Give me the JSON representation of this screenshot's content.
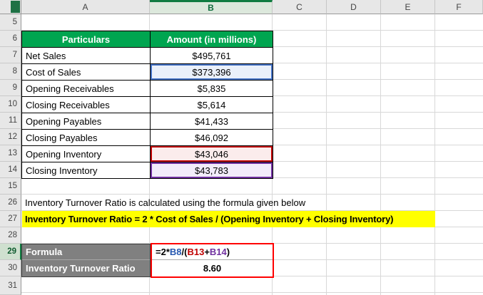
{
  "sheet": {
    "column_headers": [
      "A",
      "B",
      "C",
      "D",
      "E",
      "F"
    ],
    "row_headers": [
      "5",
      "6",
      "7",
      "8",
      "9",
      "10",
      "11",
      "12",
      "13",
      "14",
      "15",
      "26",
      "27",
      "28",
      "29",
      "30",
      "31"
    ]
  },
  "table": {
    "header": {
      "particulars": "Particulars",
      "amount": "Amount (in millions)"
    },
    "rows": [
      {
        "label": "Net Sales",
        "value": "$495,761"
      },
      {
        "label": "Cost of Sales",
        "value": "$373,396"
      },
      {
        "label": "Opening Receivables",
        "value": "$5,835"
      },
      {
        "label": "Closing Receivables",
        "value": "$5,614"
      },
      {
        "label": "Opening Payables",
        "value": "$41,433"
      },
      {
        "label": "Closing Payables",
        "value": "$46,092"
      },
      {
        "label": "Opening Inventory",
        "value": "$43,046"
      },
      {
        "label": "Closing Inventory",
        "value": "$43,783"
      }
    ]
  },
  "notes": {
    "intro": "Inventory Turnover Ratio is calculated using the formula given below",
    "formula_text": "Inventory Turnover Ratio = 2 * Cost of Sales / (Opening Inventory + Closing Inventory)"
  },
  "calc": {
    "formula_label": "Formula",
    "result_label": "Inventory Turnover Ratio",
    "formula": {
      "prefix": "=2*",
      "ref1": "B8",
      "op1": "/(",
      "ref2": "B13",
      "op2": "+",
      "ref3": "B14",
      "suffix": ")"
    },
    "result": "8.60"
  },
  "colors": {
    "table_header_green": "#00A550",
    "label_gray": "#808080",
    "highlight_yellow": "#FFFF00",
    "ref1_blue": "#2457B0",
    "ref2_red": "#C00000",
    "ref3_purple": "#7030A0",
    "result_box_red": "#FF0000",
    "selection_green": "#107C41",
    "cell_fill_blue": "#EAF0FA",
    "cell_fill_red": "#FBECEC",
    "cell_fill_purple": "#F2ECFA"
  }
}
